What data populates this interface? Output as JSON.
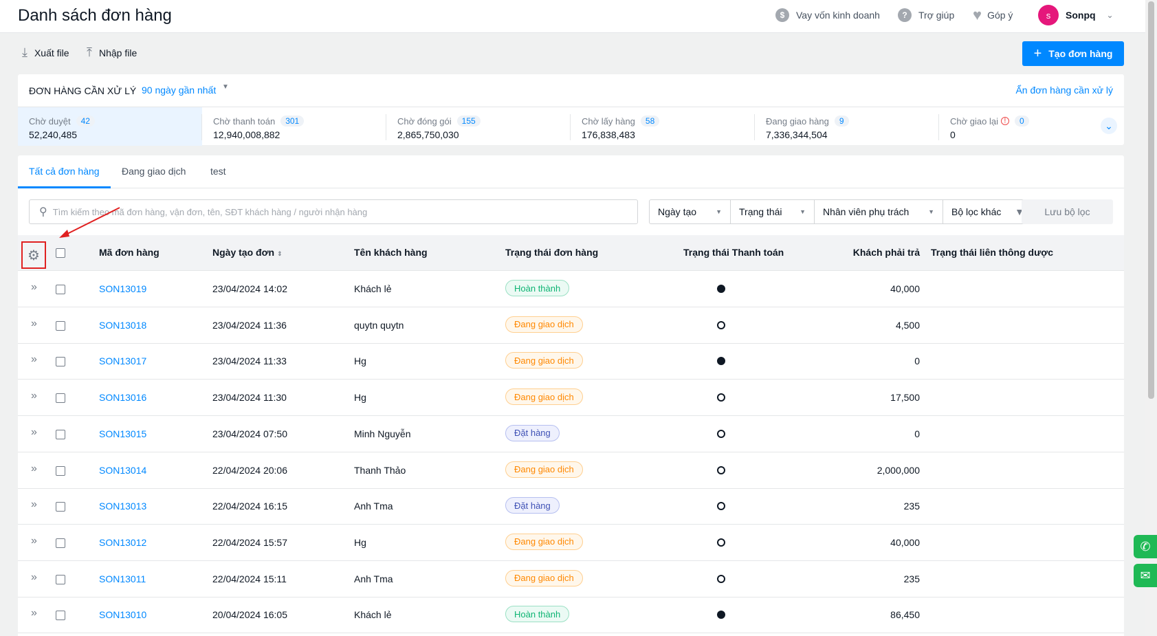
{
  "header": {
    "title": "Danh sách đơn hàng",
    "loan": "Vay vốn kinh doanh",
    "help": "Trợ giúp",
    "feedback": "Góp ý",
    "user_initial": "s",
    "user_name": "Sonpq"
  },
  "actions": {
    "export": "Xuất file",
    "import": "Nhập file",
    "create": "Tạo đơn hàng"
  },
  "pending": {
    "title": "ĐƠN HÀNG CẦN XỬ LÝ",
    "range": "90 ngày gần nhất",
    "hide": "Ẩn đơn hàng cần xử lý",
    "stats": [
      {
        "label": "Chờ duyệt",
        "count": "42",
        "value": "52,240,485"
      },
      {
        "label": "Chờ thanh toán",
        "count": "301",
        "value": "12,940,008,882"
      },
      {
        "label": "Chờ đóng gói",
        "count": "155",
        "value": "2,865,750,030"
      },
      {
        "label": "Chờ lấy hàng",
        "count": "58",
        "value": "176,838,483"
      },
      {
        "label": "Đang giao hàng",
        "count": "9",
        "value": "7,336,344,504"
      },
      {
        "label": "Chờ giao lại",
        "count": "0",
        "value": "0"
      }
    ]
  },
  "tabs": [
    "Tất cả đơn hàng",
    "Đang giao dịch",
    "test"
  ],
  "search": {
    "placeholder": "Tìm kiếm theo mã đơn hàng, vận đơn, tên, SĐT khách hàng / người nhận hàng"
  },
  "filters": [
    "Ngày tạo",
    "Trạng thái",
    "Nhân viên phụ trách",
    "Bộ lọc khác"
  ],
  "save_filter": "Lưu bộ lọc",
  "columns": {
    "code": "Mã đơn hàng",
    "date": "Ngày tạo đơn",
    "customer": "Tên khách hàng",
    "status": "Trạng thái đơn hàng",
    "payment": "Trạng thái Thanh toán",
    "amount": "Khách phải trả",
    "sync": "Trạng thái liên thông dược"
  },
  "orders": [
    {
      "code": "SON13019",
      "date": "23/04/2024 14:02",
      "customer": "Khách lẻ",
      "status": "Hoàn thành",
      "status_type": "done",
      "paid": true,
      "amount": "40,000"
    },
    {
      "code": "SON13018",
      "date": "23/04/2024 11:36",
      "customer": "quytn quytn",
      "status": "Đang giao dịch",
      "status_type": "ship",
      "paid": false,
      "amount": "4,500"
    },
    {
      "code": "SON13017",
      "date": "23/04/2024 11:33",
      "customer": "Hg",
      "status": "Đang giao dịch",
      "status_type": "ship",
      "paid": true,
      "amount": "0"
    },
    {
      "code": "SON13016",
      "date": "23/04/2024 11:30",
      "customer": "Hg",
      "status": "Đang giao dịch",
      "status_type": "ship",
      "paid": false,
      "amount": "17,500"
    },
    {
      "code": "SON13015",
      "date": "23/04/2024 07:50",
      "customer": "Minh Nguyễn",
      "status": "Đặt hàng",
      "status_type": "order",
      "paid": false,
      "amount": "0"
    },
    {
      "code": "SON13014",
      "date": "22/04/2024 20:06",
      "customer": "Thanh Thảo",
      "status": "Đang giao dịch",
      "status_type": "ship",
      "paid": false,
      "amount": "2,000,000"
    },
    {
      "code": "SON13013",
      "date": "22/04/2024 16:15",
      "customer": "Anh Tma",
      "status": "Đặt hàng",
      "status_type": "order",
      "paid": false,
      "amount": "235"
    },
    {
      "code": "SON13012",
      "date": "22/04/2024 15:57",
      "customer": "Hg",
      "status": "Đang giao dịch",
      "status_type": "ship",
      "paid": false,
      "amount": "40,000"
    },
    {
      "code": "SON13011",
      "date": "22/04/2024 15:11",
      "customer": "Anh Tma",
      "status": "Đang giao dịch",
      "status_type": "ship",
      "paid": false,
      "amount": "235"
    },
    {
      "code": "SON13010",
      "date": "20/04/2024 16:05",
      "customer": "Khách lẻ",
      "status": "Hoàn thành",
      "status_type": "done",
      "paid": true,
      "amount": "86,450"
    }
  ],
  "colors": {
    "accent": "#0088ff",
    "annotation": "#e02020"
  }
}
